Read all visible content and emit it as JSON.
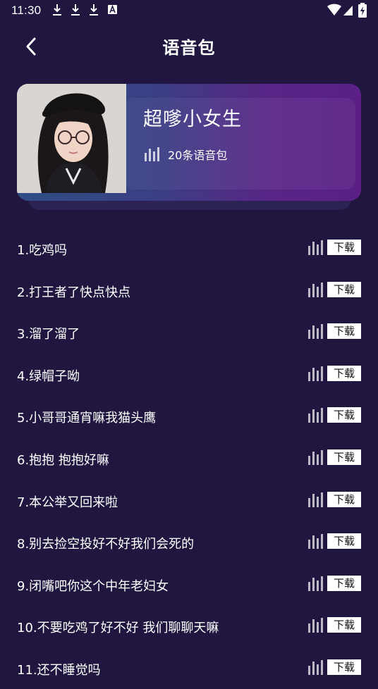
{
  "status_bar": {
    "time": "11:30"
  },
  "header": {
    "title": "语音包"
  },
  "pack": {
    "name": "超嗲小女生",
    "count_label": "20条语音包"
  },
  "list": {
    "download_label": "下载",
    "items": [
      "1.吃鸡吗",
      "2.打王者了快点快点",
      "3.溜了溜了",
      "4.绿帽子呦",
      "5.小哥哥通宵嘛我猫头鹰",
      "6.抱抱 抱抱好嘛",
      "7.本公举又回来啦",
      "8.别去捡空投好不好我们会死的",
      "9.闭嘴吧你这个中年老妇女",
      "10.不要吃鸡了好不好 我们聊聊天嘛",
      "11.还不睡觉吗"
    ]
  },
  "colors": {
    "background": "#211640",
    "card_gradient_start": "#2f4f85",
    "card_gradient_end": "#5b1f86",
    "download_button": "#ffffff"
  }
}
